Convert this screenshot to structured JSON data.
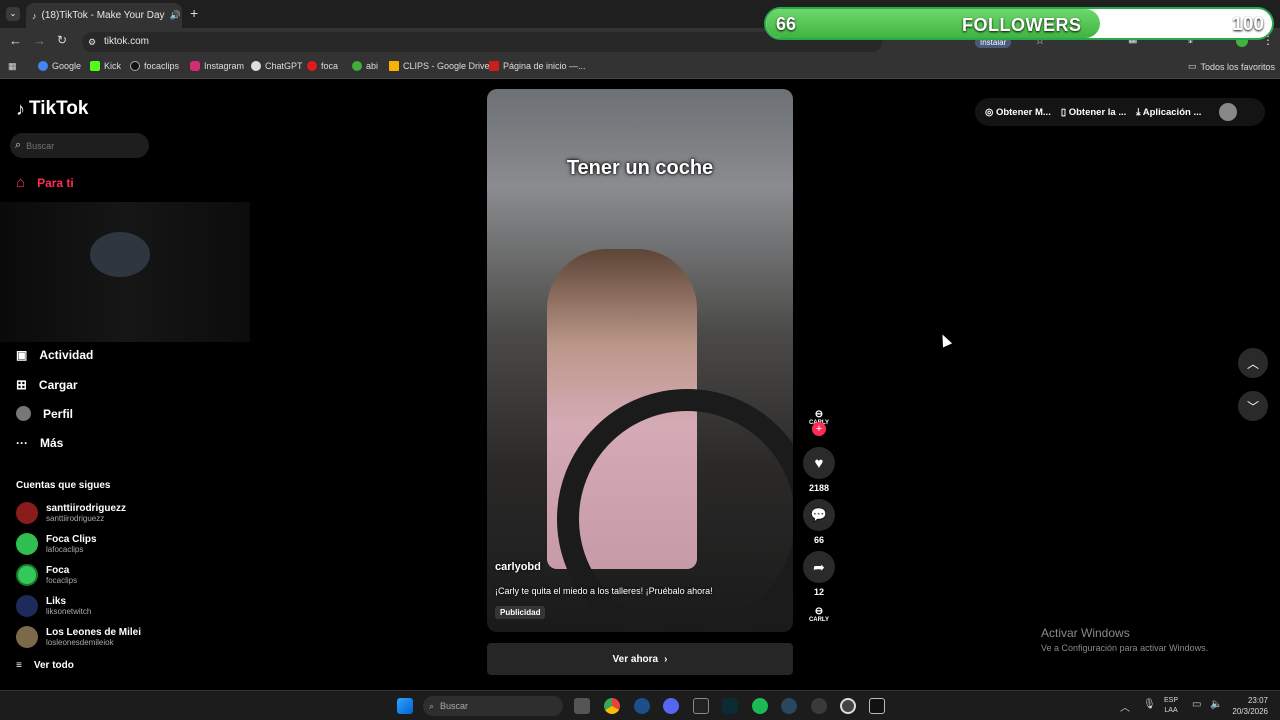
{
  "browser": {
    "tab_title": "(18)TikTok - Make Your Day",
    "url": "tiktok.com",
    "install_label": "Instalar",
    "bookmarks": [
      "Google",
      "Kick",
      "focaclips",
      "Instagram",
      "ChatGPT",
      "foca",
      "abi",
      "CLIPS - Google Drive",
      "Página de inicio —..."
    ],
    "all_favorites": "Todos los favoritos"
  },
  "overlay": {
    "current": "66",
    "label": "FOLLOWERS",
    "goal": "100",
    "progress": 0.66
  },
  "tiktok": {
    "logo": "TikTok",
    "search_placeholder": "Buscar",
    "nav": {
      "for_you": "Para ti",
      "activity": "Actividad",
      "upload": "Cargar",
      "profile": "Perfil",
      "more": "Más"
    },
    "following_title": "Cuentas que sigues",
    "accounts": [
      {
        "name": "santtiirodriguezz",
        "handle": "santtiirodriguezz",
        "color": "#8a1c1c"
      },
      {
        "name": "Foca Clips",
        "handle": "lafocaclips",
        "color": "#2fbf4f"
      },
      {
        "name": "Foca",
        "handle": "focaclips",
        "color": "#34c759"
      },
      {
        "name": "Liks",
        "handle": "liksonetwitch",
        "color": "#1d2a5a"
      },
      {
        "name": "Los Leones de Milei",
        "handle": "losleonesdemileiok",
        "color": "#7a6a4a"
      }
    ],
    "see_all": "Ver todo",
    "top_actions": [
      "Obtener M...",
      "Obtener la ...",
      "Aplicación ..."
    ],
    "video": {
      "caption_overlay": "Tener un coche",
      "author": "carlyobd",
      "description": "¡Carly te quita el miedo a los talleres! ¡Pruébalo ahora!",
      "ad_label": "Publicidad",
      "cta": "Ver ahora",
      "brand": "CARLY"
    },
    "counts": {
      "likes": "2188",
      "comments": "66",
      "shares": "12"
    }
  },
  "watermark": {
    "line1": "Activar Windows",
    "line2": "Ve a Configuración para activar Windows."
  },
  "taskbar": {
    "search": "Buscar",
    "lang1": "ESP",
    "lang2": "LAA",
    "time": "23:07",
    "date": "20/3/2026"
  }
}
